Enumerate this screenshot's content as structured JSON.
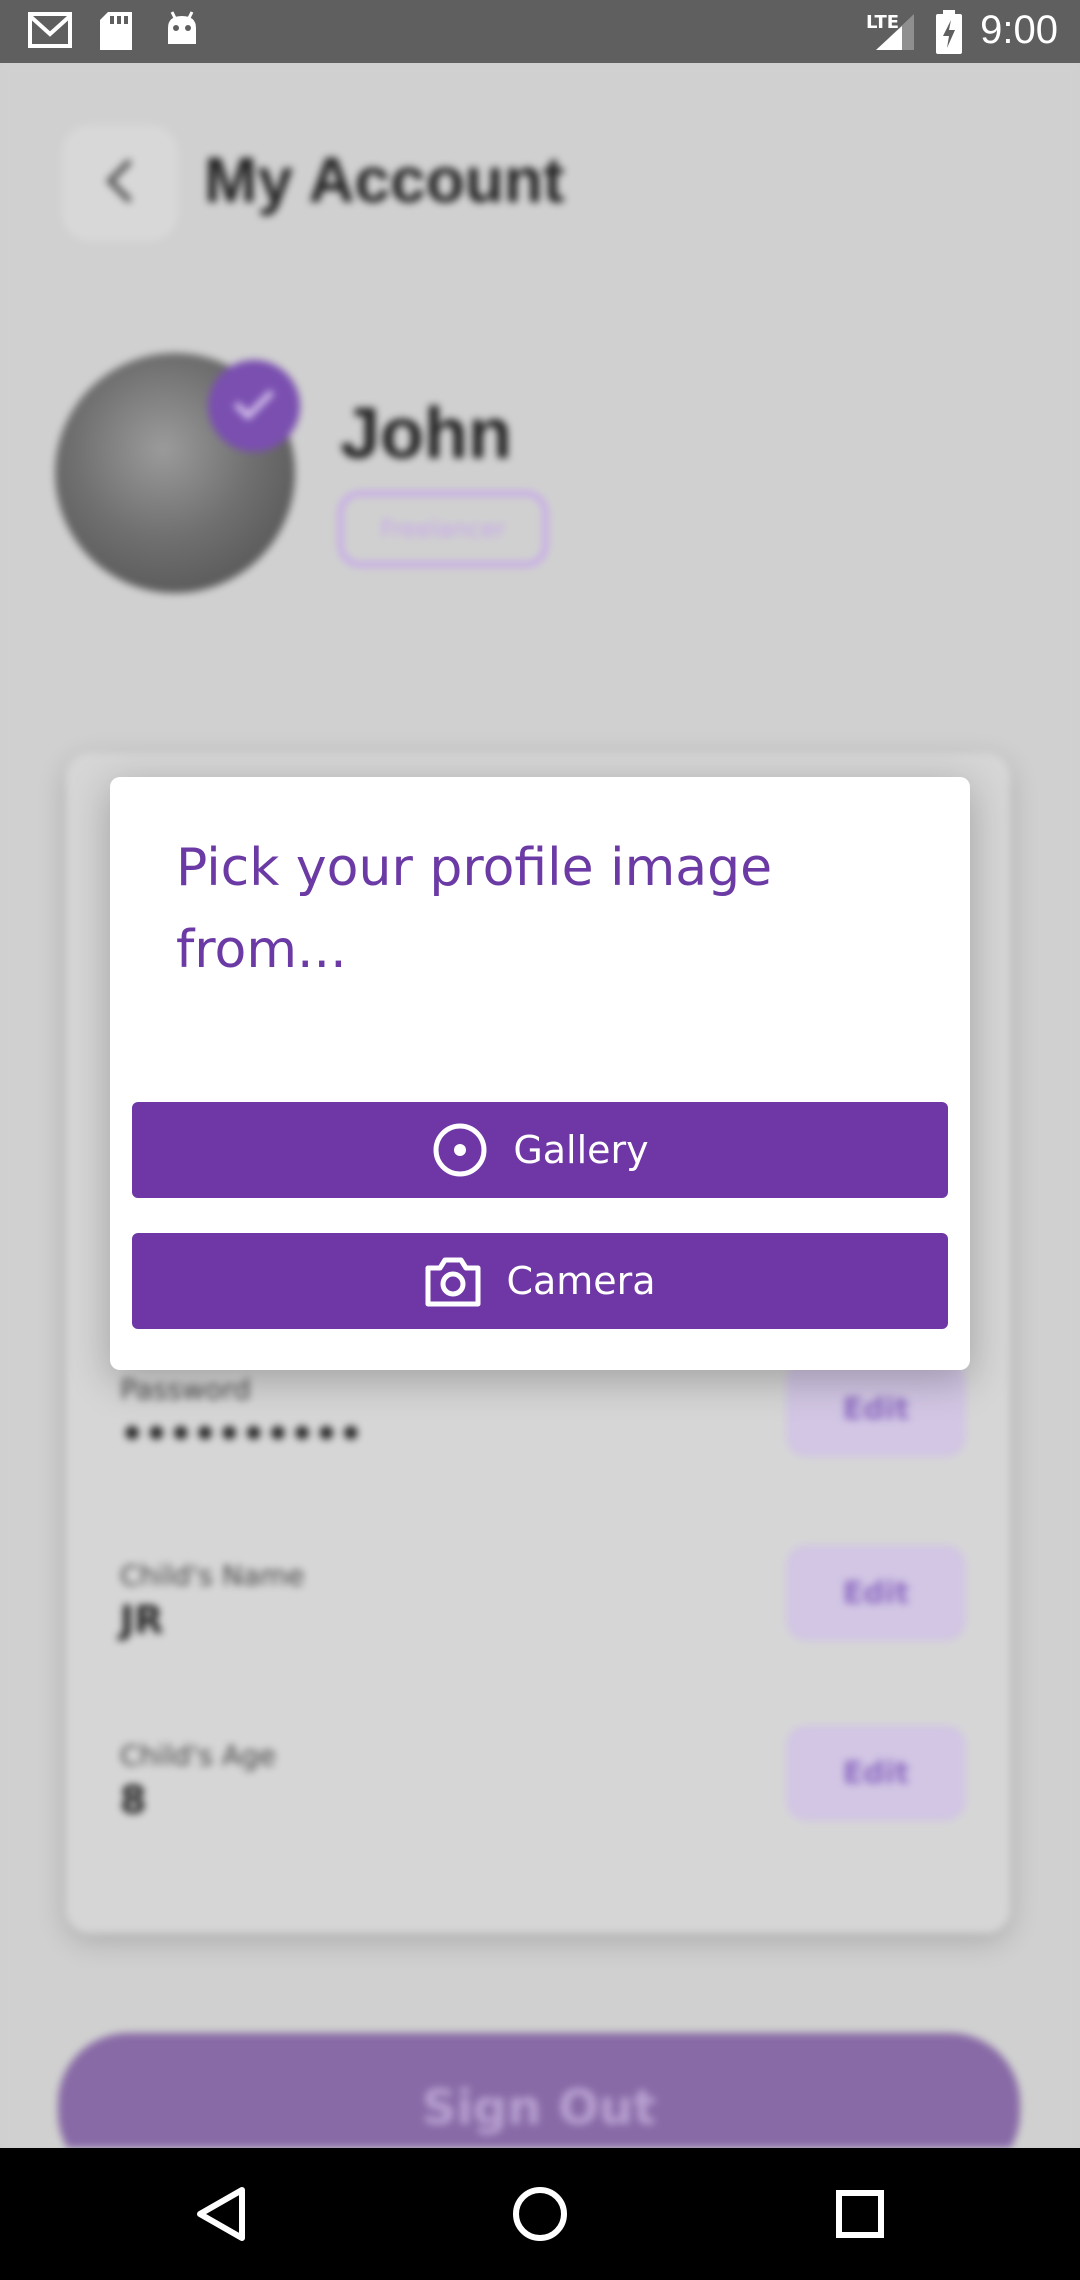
{
  "status_bar": {
    "time": "9:00",
    "network": "LTE",
    "icons": [
      "gmail-icon",
      "sd-card-icon",
      "android-icon",
      "signal-icon",
      "battery-charging-icon"
    ]
  },
  "header": {
    "title": "My Account",
    "back_icon": "chevron-left-icon"
  },
  "profile": {
    "name": "John",
    "badge": "Freelancer",
    "verified_icon": "check-icon"
  },
  "account_fields": [
    {
      "label": "Password",
      "value": "••••••••••",
      "action": "Edit"
    },
    {
      "label": "Child's Name",
      "value": "JR",
      "action": "Edit"
    },
    {
      "label": "Child's Age",
      "value": "8",
      "action": "Edit"
    }
  ],
  "sign_out_label": "Sign Out",
  "dialog": {
    "title": "Pick your profile image from...",
    "buttons": [
      {
        "label": "Gallery",
        "icon": "radio-target-icon"
      },
      {
        "label": "Camera",
        "icon": "camera-icon"
      }
    ]
  },
  "nav_bar": {
    "icons": [
      "back-triangle-icon",
      "home-circle-icon",
      "recents-square-icon"
    ]
  },
  "colors": {
    "accent": "#6f37a5",
    "dialog_title": "#6b3aa5",
    "status_bar": "#5f5f5f",
    "scrim": "#cfcfcf"
  }
}
